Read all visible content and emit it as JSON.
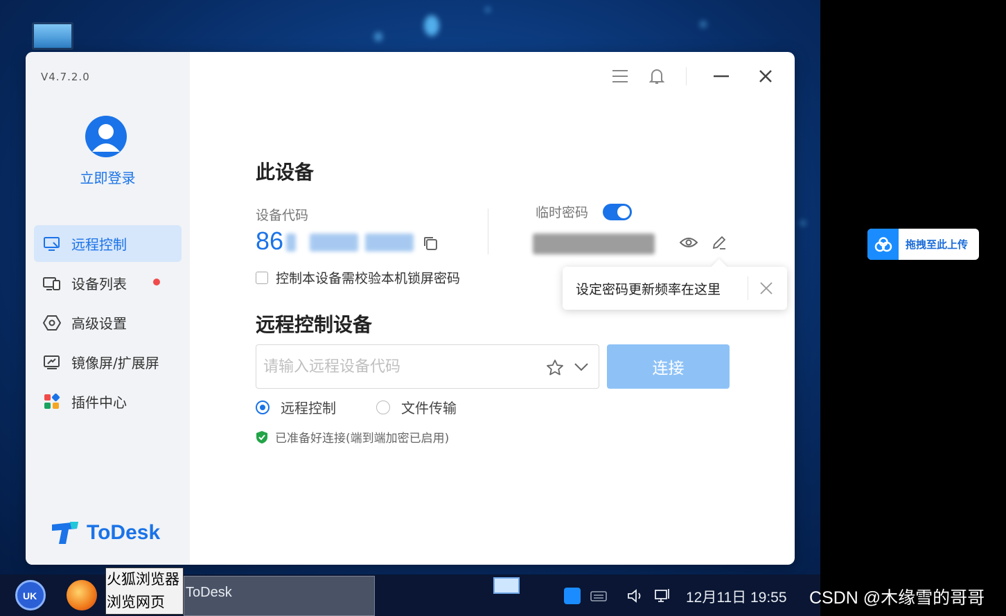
{
  "app": {
    "version": "V4.7.2.0",
    "login_label": "立即登录",
    "logo_text": "ToDesk",
    "brand_color": "#1a73e8"
  },
  "sidebar": {
    "items": [
      {
        "label": "远程控制",
        "icon": "monitor-remote-icon",
        "active": true
      },
      {
        "label": "设备列表",
        "icon": "device-list-icon",
        "badge": "red-dot"
      },
      {
        "label": "高级设置",
        "icon": "settings-hex-icon"
      },
      {
        "label": "镜像屏/扩展屏",
        "icon": "screen-mirror-icon"
      },
      {
        "label": "插件中心",
        "icon": "plugin-grid-icon"
      }
    ]
  },
  "this_device": {
    "title": "此设备",
    "code_label": "设备代码",
    "code_value": "86",
    "temp_password_label": "临时密码",
    "temp_password_enabled": true,
    "lock_screen_checkbox_label": "控制本设备需校验本机锁屏密码",
    "lock_screen_checked": false
  },
  "tooltip": {
    "text": "设定密码更新频率在这里"
  },
  "remote": {
    "title": "远程控制设备",
    "input_placeholder": "请输入远程设备代码",
    "input_value": "",
    "connect_label": "连接",
    "modes": [
      {
        "label": "远程控制",
        "selected": true
      },
      {
        "label": "文件传输",
        "selected": false
      }
    ],
    "status_text": "已准备好连接(端到端加密已启用)"
  },
  "upload_widget": {
    "label": "拖拽至此上传"
  },
  "taskbar": {
    "tooltip_line1": "火狐浏览器",
    "tooltip_line2": "浏览网页",
    "window_title": "ToDesk",
    "clock": "12月11日 19:55"
  },
  "watermark": "CSDN @木缘雪的哥哥"
}
